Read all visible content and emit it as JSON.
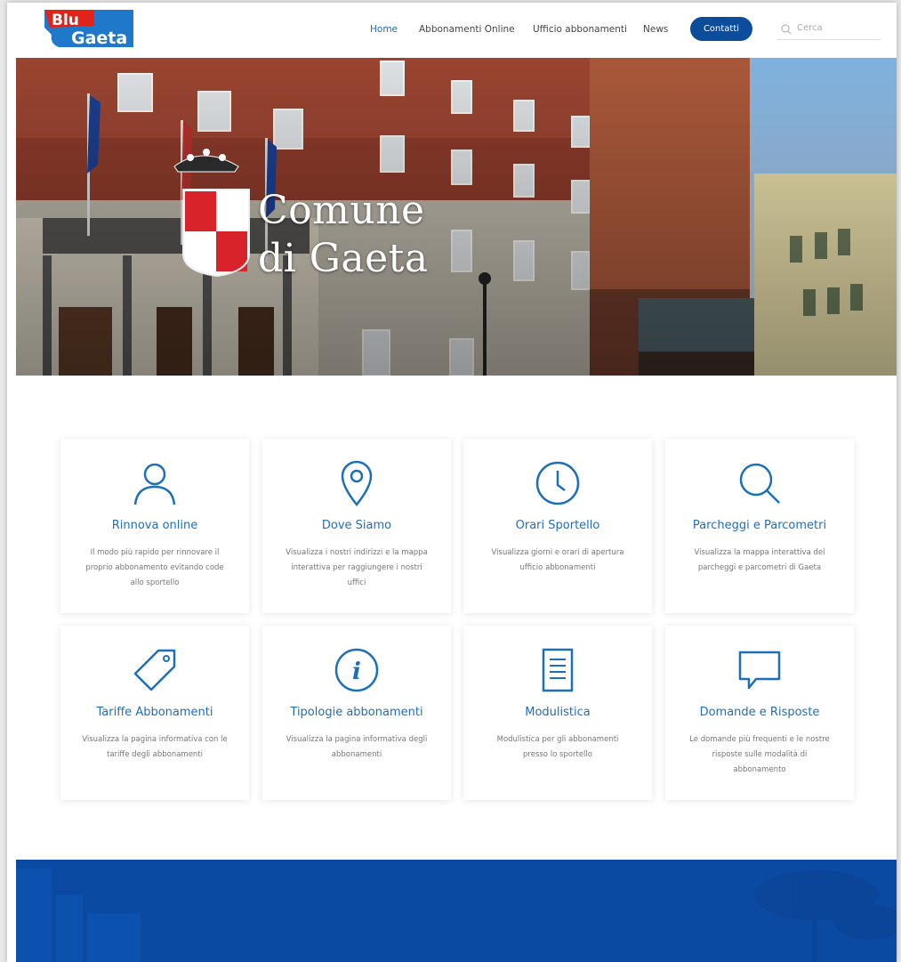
{
  "header": {
    "logo": {
      "line1": "Blu",
      "line2": "Gaeta"
    },
    "nav": [
      {
        "label": "Home",
        "active": true
      },
      {
        "label": "Abbonamenti Online",
        "active": false
      },
      {
        "label": "Ufficio abbonamenti",
        "active": false
      },
      {
        "label": "News",
        "active": false
      }
    ],
    "contatti_label": "Contatti",
    "search_placeholder": "Cerca"
  },
  "hero": {
    "title_line1": "Comune",
    "title_line2": "di Gaeta"
  },
  "cards": [
    {
      "icon": "user-icon",
      "title": "Rinnova online",
      "desc": "Il modo più rapido per rinnovare il proprio abbonamento evitando code allo sportello"
    },
    {
      "icon": "location-pin-icon",
      "title": "Dove Siamo",
      "desc": "Visualizza i nostri indirizzi e la mappa interattiva per raggiungere i nostri uffici"
    },
    {
      "icon": "clock-icon",
      "title": "Orari Sportello",
      "desc": "Visualizza giorni e orari di apertura ufficio abbonamenti"
    },
    {
      "icon": "search-icon",
      "title": "Parcheggi e Parcometri",
      "desc": "Visualizza la mappa interattiva dei parcheggi e parcometri di Gaeta"
    },
    {
      "icon": "tag-icon",
      "title": "Tariffe Abbonamenti",
      "desc": "Visualizza la pagina informativa con le tariffe degli abbonamenti"
    },
    {
      "icon": "info-icon",
      "title": "Tipologie abbonamenti",
      "desc": "Visualizza la pagina informativa degli abbonamenti"
    },
    {
      "icon": "document-icon",
      "title": "Modulistica",
      "desc": "Modulistica per gli abbonamenti presso lo sportello"
    },
    {
      "icon": "speech-bubble-icon",
      "title": "Domande e Risposte",
      "desc": "Le domande più frequenti e le nostre risposte sulle modalità di abbonamento"
    }
  ],
  "colors": {
    "accent": "#1d6fb8",
    "brand_dark": "#0b4c9b",
    "footer_blue": "#0a4aa3"
  }
}
